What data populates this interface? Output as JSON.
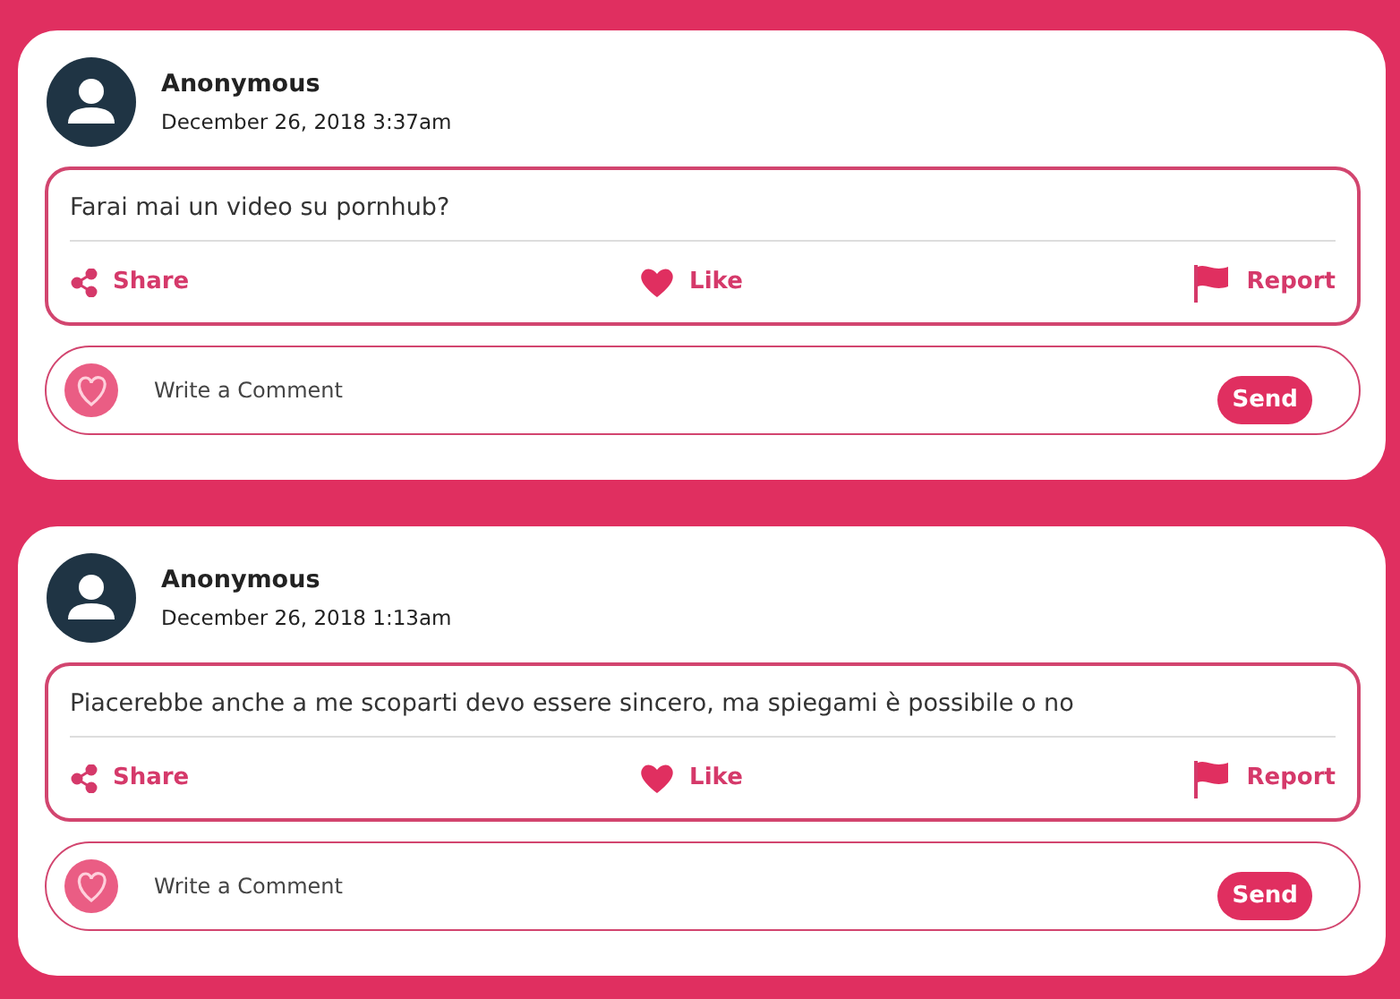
{
  "posts": [
    {
      "author": "Anonymous",
      "date": "December 26, 2018 3:37am",
      "message": "Farai mai un video su pornhub?",
      "actions": [
        "Share",
        "Like",
        "Report"
      ],
      "comment": {
        "placeholder": "Write a Comment",
        "send": "Send"
      }
    },
    {
      "author": "Anonymous",
      "date": "December 26, 2018 1:13am",
      "message": "Piacerebbe anche a me scoparti devo essere sincero, ma spiegami è possibile o no",
      "actions": [
        "Share",
        "Like",
        "Report"
      ],
      "comment": {
        "placeholder": "Write a Comment",
        "send": "Send"
      }
    }
  ]
}
